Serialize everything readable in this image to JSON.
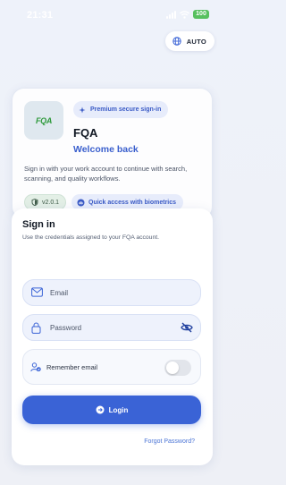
{
  "status_bar": {
    "time": "21:31",
    "battery": "100"
  },
  "header": {
    "language_button_label": "AUTO"
  },
  "hero": {
    "logo_text": "FQA",
    "badge_label": "Premium secure sign-in",
    "app_name": "FQA",
    "welcome": "Welcome back",
    "description": "Sign in with your work account to continue with search, scanning, and quality workflows.",
    "version": "v2.0.1",
    "biometrics_label": "Quick access with biometrics"
  },
  "signin": {
    "title": "Sign in",
    "subtitle": "Use the credentials assigned to your FQA account.",
    "email_placeholder": "Email",
    "email_value": "",
    "password_placeholder": "Password",
    "password_value": "",
    "remember_label": "Remember email",
    "remember_enabled": false,
    "login_label": "Login",
    "forgot_label": "Forgot Password?"
  },
  "colors": {
    "accent": "#3a63d6",
    "welcome_text": "#3a5fcd",
    "version_badge_bg": "#e3efe6",
    "battery": "#57c05f"
  },
  "icons": {
    "language": "globe-icon",
    "premium": "sparkle-icon",
    "version": "shield-icon",
    "biometrics": "fingerprint-icon",
    "email": "mail-icon",
    "password": "lock-icon",
    "password_toggle": "eye-off-icon",
    "remember": "user-shield-icon",
    "login": "login-arrow-icon"
  }
}
